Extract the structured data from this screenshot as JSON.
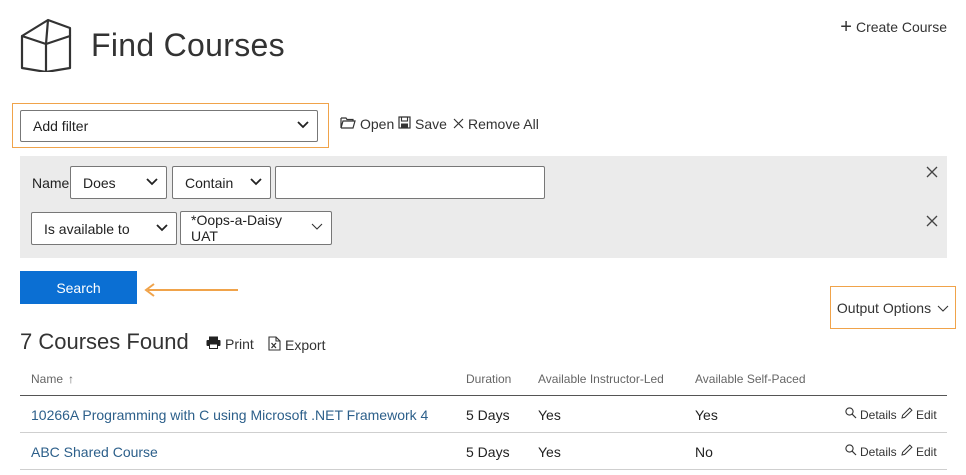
{
  "header": {
    "title": "Find Courses",
    "create_label": "Create Course"
  },
  "filter_bar": {
    "add_filter_value": "Add filter",
    "open_label": "Open",
    "save_label": "Save",
    "remove_all_label": "Remove All"
  },
  "filters": {
    "name_label": "Name",
    "operator1_value": "Does",
    "operator2_value": "Contain",
    "text_value": "",
    "availability_value": "Is available to",
    "organization_value": "*Oops-a-Daisy UAT"
  },
  "search": {
    "label": "Search"
  },
  "output": {
    "label": "Output Options"
  },
  "results": {
    "count_label": "7 Courses Found",
    "print_label": "Print",
    "export_label": "Export",
    "columns": [
      "Name",
      "Duration",
      "Available Instructor-Led",
      "Available Self-Paced"
    ],
    "sort_indicator": "↑",
    "rows": [
      {
        "name": "10266A Programming with C using Microsoft .NET Framework 4",
        "duration": "5 Days",
        "instructor_led": "Yes",
        "self_paced": "Yes",
        "details": "Details",
        "edit": "Edit"
      },
      {
        "name": "ABC Shared Course",
        "duration": "5 Days",
        "instructor_led": "Yes",
        "self_paced": "No",
        "details": "Details",
        "edit": "Edit"
      }
    ]
  },
  "colors": {
    "accent": "#0b6fd3",
    "highlight": "#f0a34a",
    "link": "#2c5f8a",
    "panel": "#ebebeb"
  }
}
